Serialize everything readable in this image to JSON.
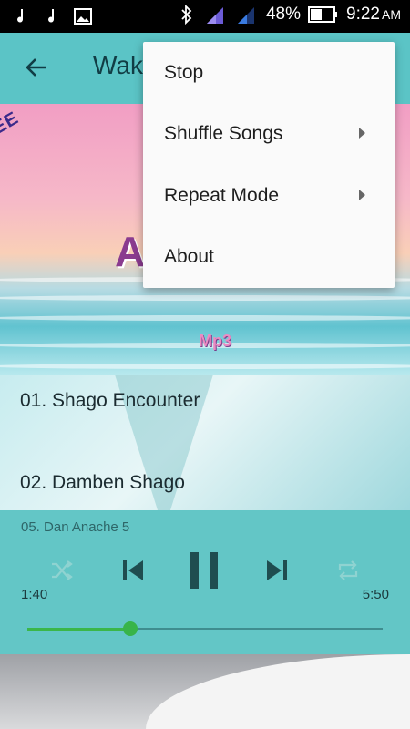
{
  "status_bar": {
    "battery": "48%",
    "time": "9:22",
    "time_suffix": "AM",
    "sim1": "1",
    "sim2": "2"
  },
  "app_bar": {
    "title": "Wake"
  },
  "banner": {
    "corner_text": "REE",
    "big_letter": "A",
    "mp3_text": "Mp3"
  },
  "songs": [
    "01. Shago Encounter",
    "02. Damben Shago"
  ],
  "player": {
    "now_playing": "05. Dan Anache 5",
    "elapsed": "1:40",
    "duration": "5:50",
    "progress": 0.29
  },
  "menu": {
    "items": [
      {
        "label": "Stop",
        "has_submenu": false
      },
      {
        "label": "Shuffle Songs",
        "has_submenu": true
      },
      {
        "label": "Repeat Mode",
        "has_submenu": true
      },
      {
        "label": "About",
        "has_submenu": false
      }
    ]
  },
  "colors": {
    "app_bar": "#5bc4c6",
    "player": "#63c6c6",
    "seek_accent": "#38b449"
  }
}
